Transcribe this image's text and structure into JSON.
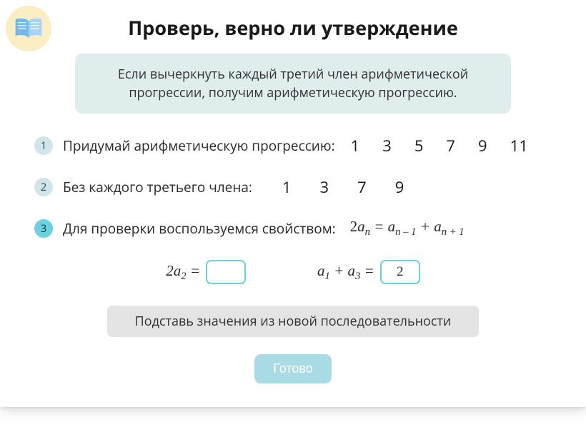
{
  "title": "Проверь, верно ли утверждение",
  "statement": "Если вычеркнуть каждый третий член арифметической прогрессии, получим арифметическую прогрессию.",
  "steps": {
    "s1": {
      "num": "1",
      "text": "Придумай арифметическую прогрессию:"
    },
    "s2": {
      "num": "2",
      "text": "Без каждого третьего члена:"
    },
    "s3": {
      "num": "3",
      "text": "Для проверки воспользуемся свойством:"
    }
  },
  "sequence1": [
    "1",
    "3",
    "5",
    "7",
    "9",
    "11"
  ],
  "sequence2": [
    "1",
    "3",
    "7",
    "9"
  ],
  "property_formula": {
    "lhs": "2aₙ",
    "rhs1": "aₙ ₋ ₁",
    "rhs2": "aₙ ₊ ₁"
  },
  "inputs": {
    "left_label_pre": "2",
    "left_label_var": "a",
    "left_label_sub": "2",
    "left_value": "",
    "right_label_a1": "a",
    "right_label_sub1": "1",
    "right_label_a3": "a",
    "right_label_sub3": "3",
    "right_value": "2"
  },
  "hint": "Подставь значения из новой последовательности",
  "done": "Готово"
}
